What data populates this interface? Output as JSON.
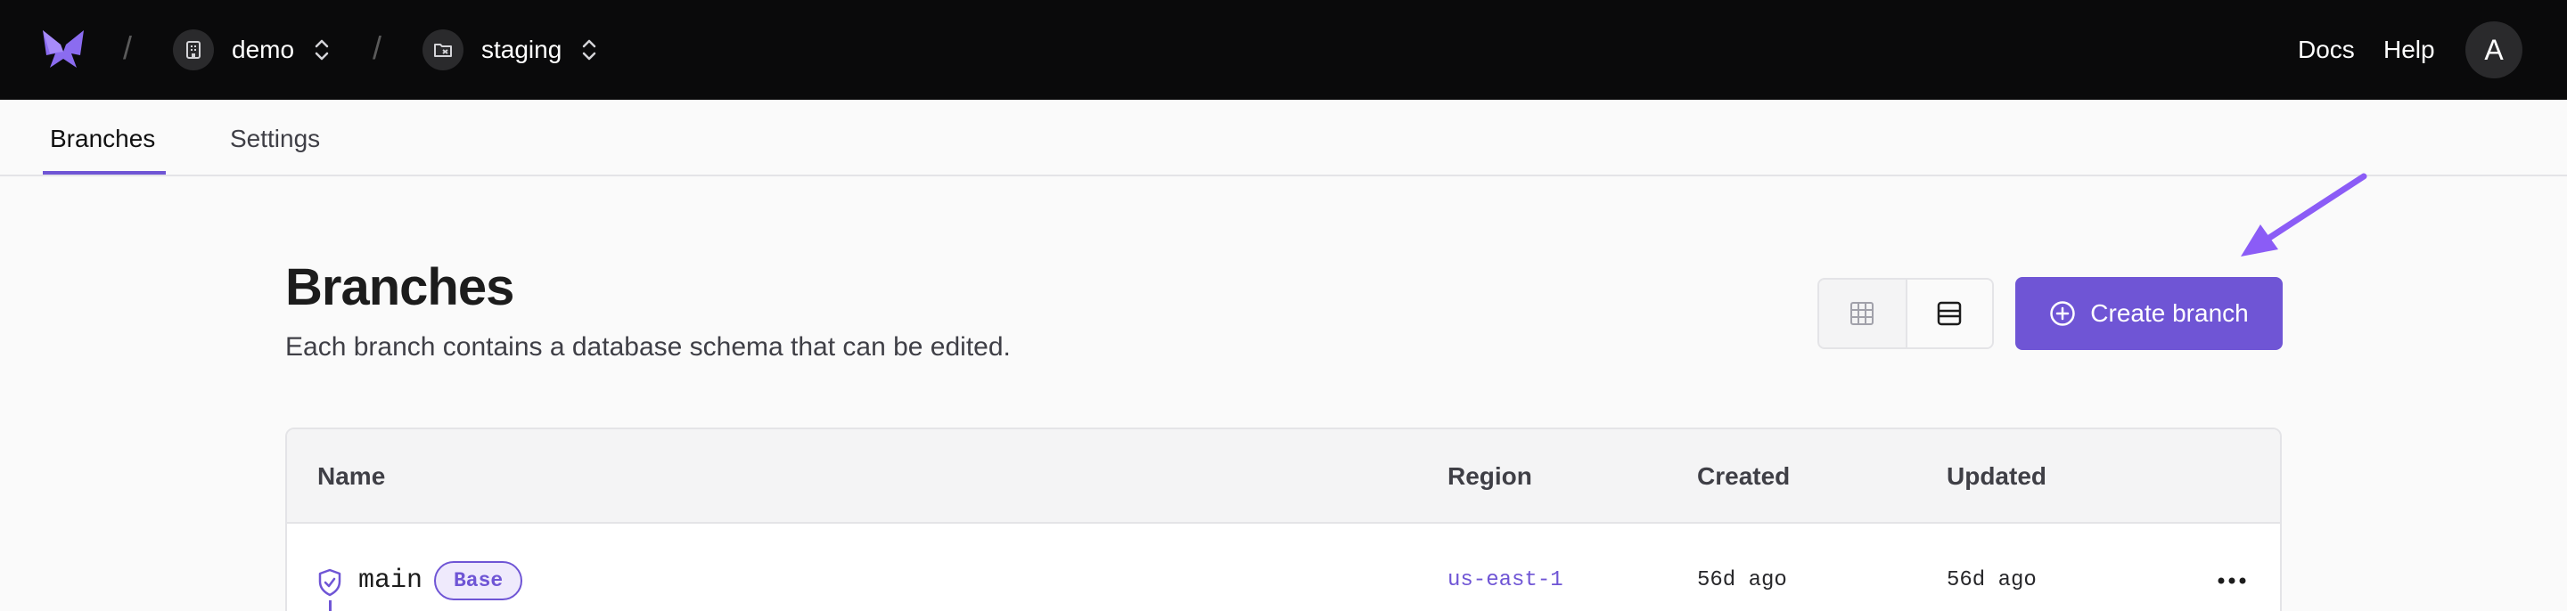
{
  "topbar": {
    "org": {
      "label": "demo",
      "icon": "building-icon"
    },
    "database": {
      "label": "staging",
      "icon": "folder-database-icon"
    },
    "links": {
      "docs": "Docs",
      "help": "Help"
    },
    "avatar_initial": "A"
  },
  "tabs": [
    {
      "label": "Branches",
      "active": true
    },
    {
      "label": "Settings",
      "active": false
    }
  ],
  "page": {
    "title": "Branches",
    "subtitle": "Each branch contains a database schema that can be edited."
  },
  "view_toggle": {
    "options": [
      "grid-icon",
      "list-icon"
    ],
    "selected": "list-icon"
  },
  "create_button": {
    "label": "Create branch",
    "icon": "plus-circle-icon"
  },
  "table": {
    "columns": [
      "Name",
      "Region",
      "Created",
      "Updated"
    ],
    "rows": [
      {
        "name": "main",
        "badge": "Base",
        "region": "us-east-1",
        "created": "56d ago",
        "updated": "56d ago"
      }
    ]
  },
  "colors": {
    "accent": "#6f55d5",
    "topbar_bg": "#0a0a0b",
    "page_bg": "#fafafa"
  }
}
